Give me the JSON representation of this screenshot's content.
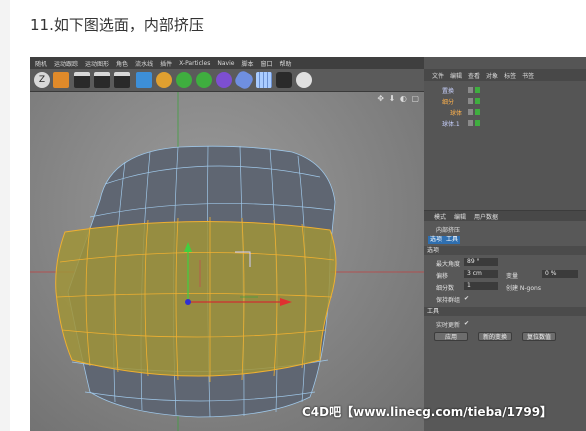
{
  "step": {
    "title": "11.如下图选面，内部挤压"
  },
  "menubar": [
    "随机",
    "运动跟踪",
    "运动图形",
    "角色",
    "流水线",
    "插件",
    "X-Particles",
    "Navie",
    "脚本",
    "窗口",
    "帮助"
  ],
  "toolbar": {
    "icons": [
      "undo-icon",
      "select-icon",
      "clapper-icon",
      "clapper-icon",
      "clapper-icon",
      "cube-icon",
      "pen-icon",
      "gear-icon",
      "gear-icon",
      "nurbs-icon",
      "deformer-icon",
      "grid-icon",
      "camera-icon",
      "light-icon"
    ]
  },
  "viewport": {
    "nav_icons": "✥ ⬇ ◐ ▢"
  },
  "object_manager": {
    "menu": [
      "文件",
      "编辑",
      "查看",
      "对象",
      "标签",
      "书签"
    ],
    "objects": [
      {
        "name": "置换",
        "color": "#c9d2ff"
      },
      {
        "name": "细分",
        "color": "#ffb24d"
      },
      {
        "name": "球体",
        "color": "#ffb24d"
      },
      {
        "name": "球体.1",
        "color": "#c9d2ff"
      }
    ]
  },
  "attributes": {
    "menu": [
      "模式",
      "编辑",
      "用户数据"
    ],
    "tool_name": "内部挤压",
    "tabs": [
      "选项",
      "工具"
    ],
    "section_options": "选项",
    "max_angle_label": "最大角度",
    "max_angle_value": "89 °",
    "offset_label": "偏移",
    "offset_value": "3 cm",
    "variance_label": "变量",
    "variance_value": "0 %",
    "subdivision_label": "细分数",
    "subdivision_value": "1",
    "create_ngons_label": "创建 N-gons",
    "keep_groups_label": "保持群组",
    "keep_groups_check": "✔",
    "section_tool": "工具",
    "realtime_label": "实时更新",
    "realtime_check": "✔",
    "buttons": [
      "应用",
      "新的变换",
      "复位数值"
    ]
  },
  "watermark": "C4D吧【www.linecg.com/tieba/1799】"
}
